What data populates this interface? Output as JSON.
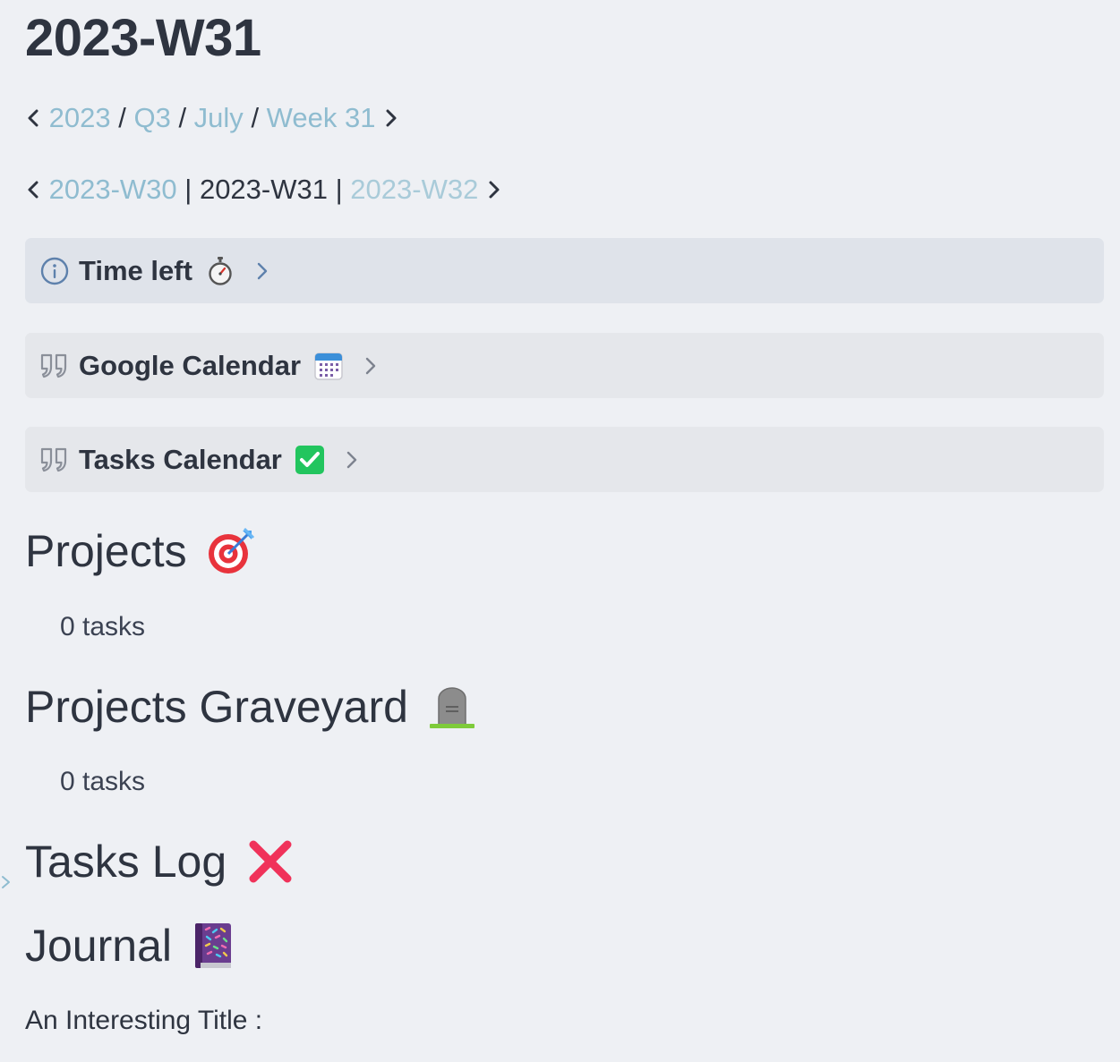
{
  "title": "2023-W31",
  "breadcrumb": {
    "items": [
      "2023",
      "Q3",
      "July",
      "Week 31"
    ],
    "separator": "/"
  },
  "week_nav": {
    "prev": "2023-W30",
    "current": "2023-W31",
    "next": "2023-W32",
    "separator": "|"
  },
  "callouts": [
    {
      "title": "Time left",
      "icon": "info-icon",
      "emoji": "stopwatch-icon"
    },
    {
      "title": "Google Calendar",
      "icon": "quote-icon",
      "emoji": "calendar-icon"
    },
    {
      "title": "Tasks Calendar",
      "icon": "quote-icon",
      "emoji": "check-mark-icon"
    }
  ],
  "sections": {
    "projects": {
      "heading": "Projects",
      "emoji": "direct-hit-icon",
      "tasks": "0 tasks"
    },
    "graveyard": {
      "heading": "Projects Graveyard",
      "emoji": "headstone-icon",
      "tasks": "0 tasks"
    },
    "tasks_log": {
      "heading": "Tasks Log",
      "emoji": "cross-mark-icon"
    },
    "journal": {
      "heading": "Journal",
      "emoji": "notebook-icon",
      "text": "An Interesting Title :"
    }
  },
  "colors": {
    "background": "#eef0f4",
    "text": "#2e3440",
    "link": "#8fbcd0",
    "callout_info_bg": "#dfe3ea",
    "callout_quote_bg": "#e5e7eb"
  }
}
